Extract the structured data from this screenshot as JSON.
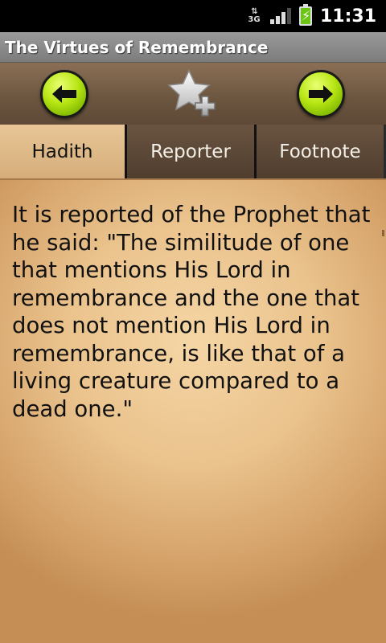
{
  "status_bar": {
    "network_type": "3G",
    "time": "11:31",
    "signal_level": 0.75,
    "battery_state": "charging"
  },
  "app": {
    "title": "The Virtues of Remembrance"
  },
  "toolbar": {
    "prev_icon": "arrow-left-icon",
    "favorite_icon": "star-add-icon",
    "next_icon": "arrow-right-icon",
    "accent_color": "#b8e614"
  },
  "tabs": [
    {
      "label": "Hadith",
      "selected": true
    },
    {
      "label": "Reporter",
      "selected": false
    },
    {
      "label": "Footnote",
      "selected": false
    }
  ],
  "content": {
    "text": "It is reported of the Prophet that he said: \"The similitude of one that mentions His Lord in remembrance and the one that does not mention His Lord in remembrance, is like that of a living creature compared to a dead one.\""
  }
}
